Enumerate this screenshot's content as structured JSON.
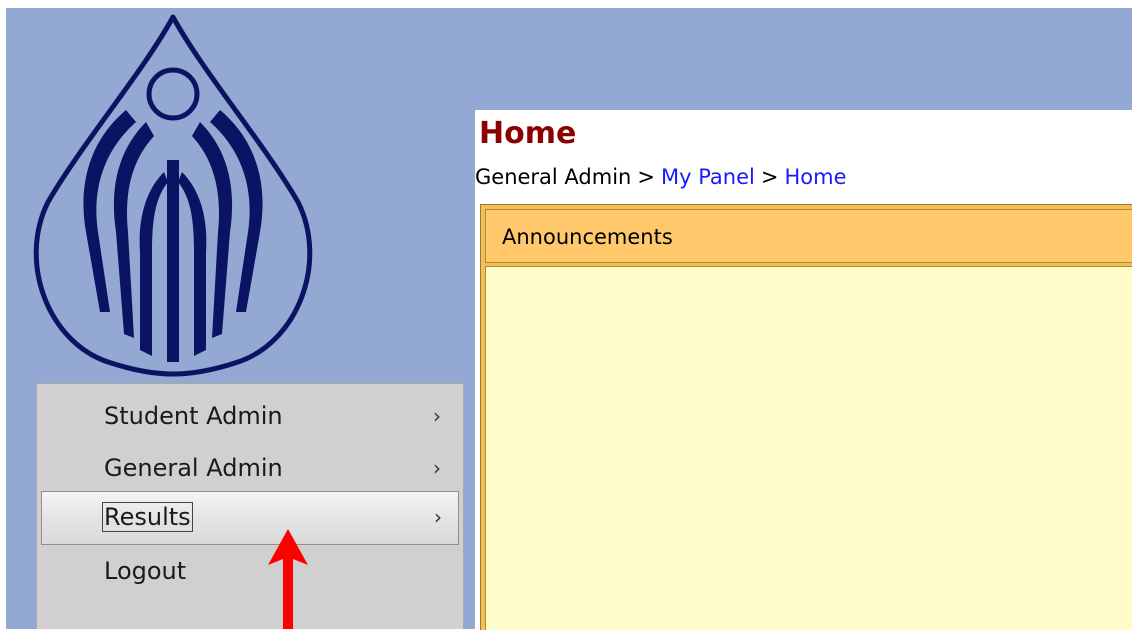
{
  "page": {
    "title": "Home"
  },
  "breadcrumb": {
    "root": "General Admin",
    "separator": ">",
    "items": [
      "My Panel",
      "Home"
    ]
  },
  "announcements": {
    "header": "Announcements"
  },
  "menu": {
    "items": [
      {
        "label": "Student Admin",
        "chevron": "›",
        "state": "normal"
      },
      {
        "label": "General Admin",
        "chevron": "›",
        "state": "normal"
      },
      {
        "label": "Results",
        "chevron": "›",
        "state": "hover"
      },
      {
        "label": "Logout",
        "chevron": "",
        "state": "normal"
      }
    ]
  },
  "icons": {
    "logo": "institution-logo-icon",
    "annotation": "red-arrow-icon"
  },
  "colors": {
    "page_background": "#94a8d4",
    "title": "#8b0000",
    "link": "#1a1aff",
    "panel_header": "#ffc96b",
    "panel_body": "#fffccc",
    "menu_background": "#d0d0d0",
    "logo": "#0b1462",
    "arrow": "#ff0000"
  }
}
